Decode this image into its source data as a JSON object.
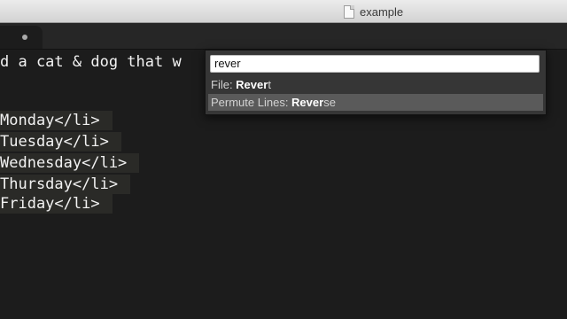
{
  "window": {
    "title": "example"
  },
  "tab": {
    "icon": "modified-dot-icon"
  },
  "editor": {
    "first_line": "d a cat & dog that w",
    "lines": [
      "Monday</li>",
      "Tuesday</li>",
      "Wednesday</li>",
      "Thursday</li>",
      "Friday</li>"
    ]
  },
  "palette": {
    "query": "rever",
    "results": [
      {
        "prefix": "File: ",
        "match": "Rever",
        "rest": "t",
        "selected": false
      },
      {
        "prefix": "Permute Lines: ",
        "match": "Rever",
        "rest": "se",
        "selected": true
      }
    ]
  },
  "colors": {
    "background": "#1c1c1c",
    "palette_bg": "#363636",
    "selected_row": "#5a5a5a"
  }
}
